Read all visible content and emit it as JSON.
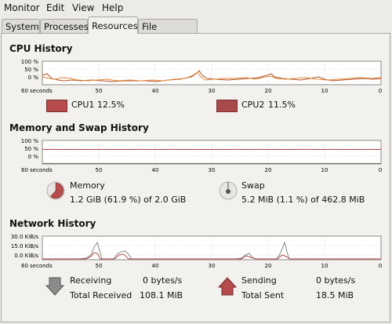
{
  "menu": [
    "Monitor",
    "Edit",
    "View",
    "Help"
  ],
  "tabs": [
    {
      "label": "System",
      "active": false
    },
    {
      "label": "Processes",
      "active": false
    },
    {
      "label": "Resources",
      "active": true
    },
    {
      "label": "File Systems",
      "active": false
    }
  ],
  "time_axis": [
    "60 seconds",
    "50",
    "40",
    "30",
    "20",
    "10",
    "0"
  ],
  "cpu": {
    "title": "CPU History",
    "y_ticks": [
      "100 %",
      "50 %",
      "0 %"
    ],
    "cpu1": {
      "label": "CPU1",
      "value": "12.5%",
      "color": "#b54b4b"
    },
    "cpu2": {
      "label": "CPU2",
      "value": "11.5%",
      "color": "#a84a4a"
    },
    "series_colors": {
      "cpu1": "#b2562d",
      "cpu2": "#e08a3a"
    }
  },
  "memory": {
    "title": "Memory and Swap History",
    "y_ticks": [
      "100 %",
      "50 %",
      "0 %"
    ],
    "mem_label": "Memory",
    "mem_value": "1.2 GiB (61.9 %) of 2.0 GiB",
    "swap_label": "Swap",
    "swap_value": "5.2 MiB (1.1 %) of 462.8 MiB",
    "mem_fraction": 0.619,
    "swap_fraction": 0.011,
    "mem_color": "#b54b4b",
    "swap_color": "#6b6b6b"
  },
  "network": {
    "title": "Network History",
    "y_ticks": [
      "30.0 KiB/s",
      "15.0 KiB/s",
      "0.0 KiB/s"
    ],
    "receiving_label": "Receiving",
    "receiving_value": "0 bytes/s",
    "total_received_label": "Total Received",
    "total_received_value": "108.1 MiB",
    "sending_label": "Sending",
    "sending_value": "0 bytes/s",
    "total_sent_label": "Total Sent",
    "total_sent_value": "18.5 MiB",
    "recv_color": "#8a8a8a",
    "send_color": "#b54b4b"
  }
}
